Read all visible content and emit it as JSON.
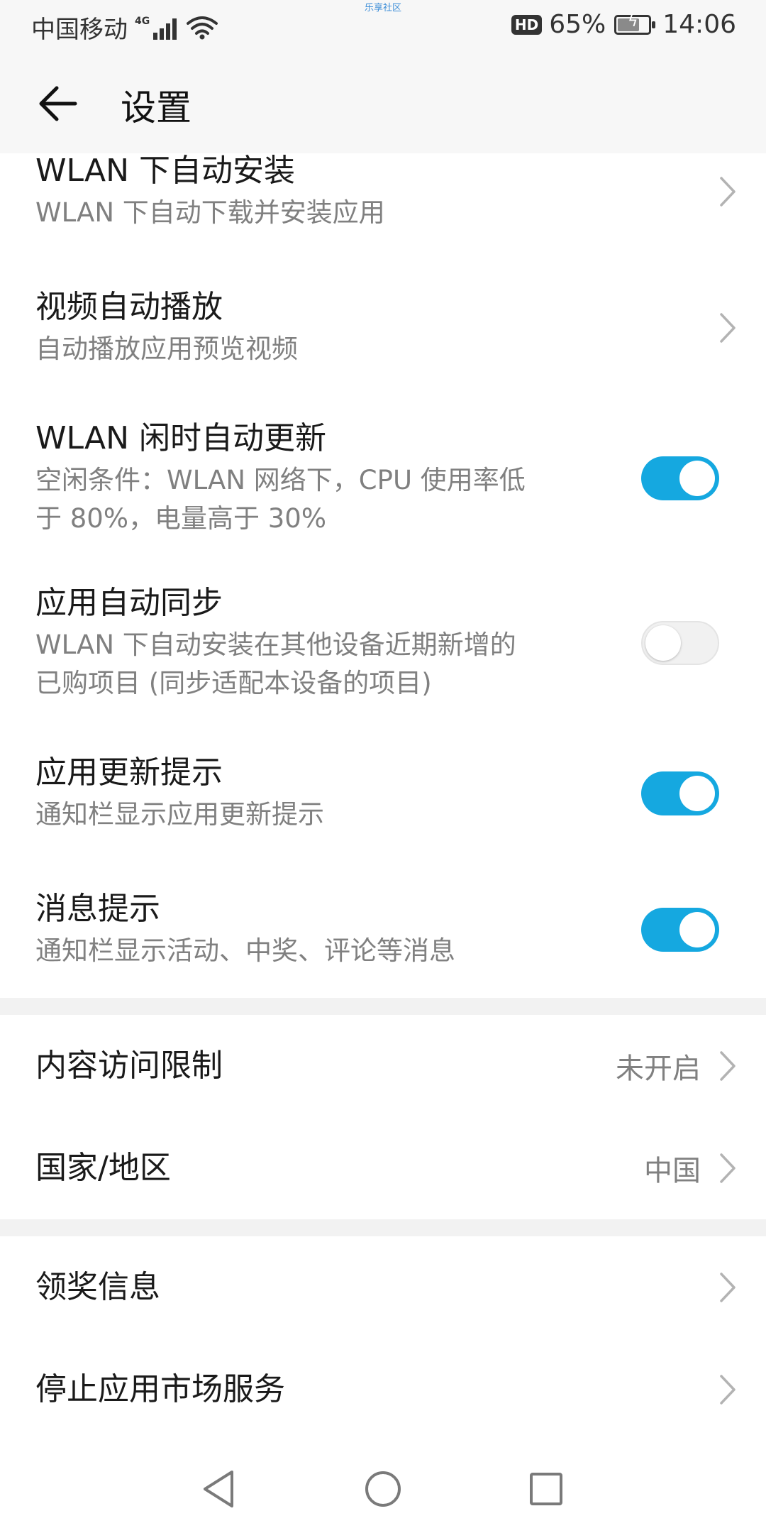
{
  "status_bar": {
    "carrier": "中国移动",
    "network_tag": "4G",
    "watermark": "乐享社区",
    "hd_label": "HD",
    "battery_percent": "65%",
    "battery_level": 0.65,
    "time": "14:06"
  },
  "app_bar": {
    "back_icon": "arrow-left-icon",
    "title": "设置"
  },
  "colors": {
    "accent": "#15a8e0",
    "toggle_off": "#f1f1f1",
    "secondary_text": "#808080"
  },
  "settings": {
    "wlan_auto_install": {
      "title": "WLAN 下自动安装",
      "subtitle": "WLAN 下自动下载并安装应用"
    },
    "video_autoplay": {
      "title": "视频自动播放",
      "subtitle": "自动播放应用预览视频"
    },
    "wlan_idle_update": {
      "title": "WLAN 闲时自动更新",
      "subtitle_line1": "空闲条件：WLAN 网络下，CPU 使用率低",
      "subtitle_line2": "于 80%，电量高于 30%",
      "enabled": true
    },
    "app_auto_sync": {
      "title": "应用自动同步",
      "subtitle_line1": "WLAN 下自动安装在其他设备近期新增的",
      "subtitle_line2": "已购项目 (同步适配本设备的项目)",
      "enabled": false
    },
    "update_hint": {
      "title": "应用更新提示",
      "subtitle": "通知栏显示应用更新提示",
      "enabled": true
    },
    "message_hint": {
      "title": "消息提示",
      "subtitle": "通知栏显示活动、中奖、评论等消息",
      "enabled": true
    },
    "content_restriction": {
      "title": "内容访问限制",
      "value": "未开启"
    },
    "country_region": {
      "title": "国家/地区",
      "value": "中国"
    },
    "prize_info": {
      "title": "领奖信息"
    },
    "stop_service": {
      "title": "停止应用市场服务"
    }
  },
  "nav_bar": {
    "back": "triangle-back-icon",
    "home": "circle-home-icon",
    "recents": "square-recents-icon"
  }
}
